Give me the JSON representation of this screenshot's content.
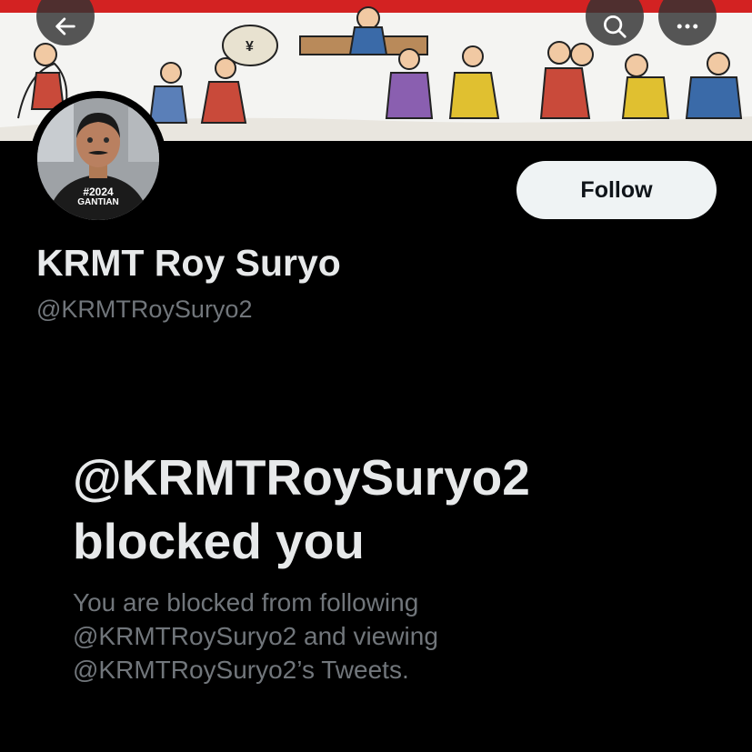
{
  "header": {
    "back_icon": "arrow-left-icon",
    "search_icon": "search-icon",
    "more_icon": "more-horizontal-icon"
  },
  "banner": {
    "description": "cartoon-banner",
    "sign_text": "¥",
    "accent": "#d32222"
  },
  "profile": {
    "display_name": "KRMT Roy Suryo",
    "handle": "@KRMTRoySuryo2",
    "avatar_shirt_line1": "#2024",
    "avatar_shirt_line2": "GANTIAN",
    "follow_label": "Follow"
  },
  "blocked": {
    "title": "@KRMTRoySuryo2 blocked you",
    "description": "You are blocked from following @KRMTRoySuryo2 and viewing @KRMTRoySuryo2’s Tweets."
  },
  "colors": {
    "background": "#000000",
    "primary_text": "#e7e9ea",
    "secondary_text": "#71767b",
    "follow_button_bg": "#eff3f4"
  }
}
